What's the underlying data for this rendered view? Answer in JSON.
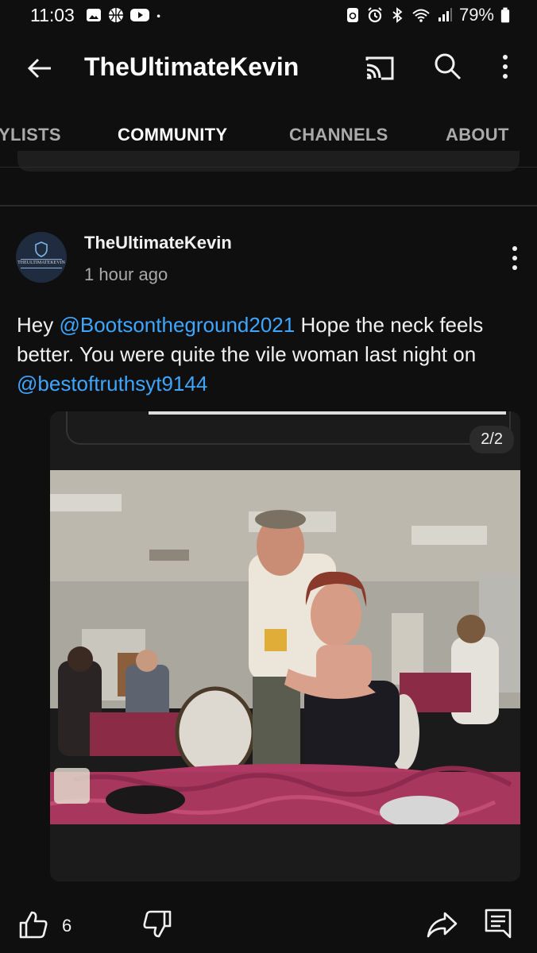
{
  "status_bar": {
    "time": "11:03",
    "battery": "79%",
    "left_icons": [
      "gallery-icon",
      "basketball-icon",
      "youtube-icon",
      "dot-icon"
    ],
    "right_icons": [
      "recycle-icon",
      "alarm-icon",
      "bluetooth-icon",
      "wifi-icon",
      "signal-icon",
      "battery-icon"
    ]
  },
  "app_bar": {
    "title": "TheUltimateKevin",
    "icons": [
      "back-arrow-icon",
      "cast-icon",
      "search-icon",
      "more-vert-icon"
    ]
  },
  "tabs": [
    {
      "label": "YLISTS",
      "active": false
    },
    {
      "label": "COMMUNITY",
      "active": true
    },
    {
      "label": "CHANNELS",
      "active": false
    },
    {
      "label": "ABOUT",
      "active": false
    }
  ],
  "post": {
    "author": "TheUltimateKevin",
    "avatar_text": "THEULTIMATEKEVIN",
    "time": "1 hour ago",
    "body": {
      "t1": "Hey ",
      "mention1": "@Bootsontheground2021",
      "t2": "  Hope the neck feels better.  You were quite the vile woman last night on ",
      "mention2": "@bestoftruthsyt9144"
    },
    "image_counter": "2/2",
    "likes": "6"
  },
  "colors": {
    "background": "#0f0f0f",
    "mention": "#3ea6ff",
    "text": "#f1f1f1",
    "secondary_text": "#aaaaaa"
  }
}
